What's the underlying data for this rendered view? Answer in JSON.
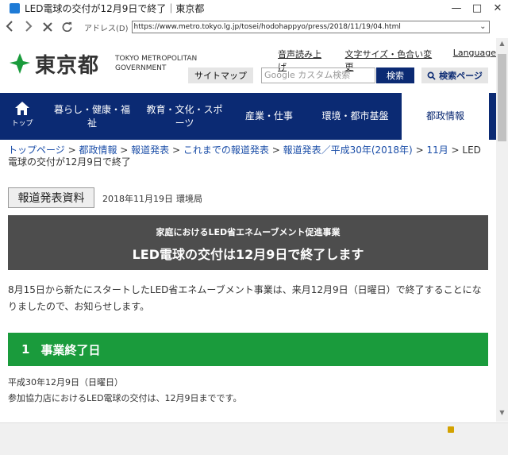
{
  "window": {
    "title": "LED電球の交付が12月9日で終了｜東京都",
    "min": "—",
    "max": "□",
    "close": "✕"
  },
  "navbar": {
    "back_icon": "back-arrow-icon",
    "forward_icon": "forward-arrow-icon",
    "stop_icon": "stop-icon",
    "refresh_icon": "refresh-icon",
    "address_label": "アドレス(D)",
    "url": "https://www.metro.tokyo.lg.jp/tosei/hodohappyo/press/2018/11/19/04.html"
  },
  "header": {
    "logo_text": "東京都",
    "logo_en_line1": "TOKYO METROPOLITAN",
    "logo_en_line2": "GOVERNMENT",
    "util_links": [
      "音声読み上げ",
      "文字サイズ・色合い変更",
      "Language"
    ],
    "sitemap": "サイトマップ",
    "search_placeholder": "Google カスタム検索",
    "search_button": "検索",
    "search_page_button": "検索ページ"
  },
  "gnav": {
    "home": "トップ",
    "items": [
      "暮らし・健康・福祉",
      "教育・文化・スポーツ",
      "産業・仕事",
      "環境・都市基盤",
      "都政情報"
    ]
  },
  "breadcrumb": {
    "items": [
      "トップページ",
      "都政情報",
      "報道発表",
      "これまでの報道発表",
      "報道発表／平成30年(2018年)",
      "11月"
    ],
    "sep": " > ",
    "current": "LED電球の交付が12月9日で終了"
  },
  "press": {
    "label": "報道発表資料",
    "date": "2018年11月19日",
    "dept": "環境局"
  },
  "headline": {
    "sub": "家庭におけるLED省エネムーブメント促進事業",
    "main": "LED電球の交付は12月9日で終了します"
  },
  "intro": "8月15日から新たにスタートしたLED省エネムーブメント事業は、来月12月9日（日曜日）で終了することになりましたので、お知らせします。",
  "section1": {
    "num": "1",
    "title": "事業終了日",
    "line1": "平成30年12月9日（日曜日）",
    "line2": "参加協力店におけるLED電球の交付は、12月9日までです。"
  },
  "colors": {
    "nav_bg": "#0b2a73",
    "headline_bg": "#4d4d4d",
    "section_bg": "#1a9b3c",
    "link": "#1b4ea8"
  }
}
